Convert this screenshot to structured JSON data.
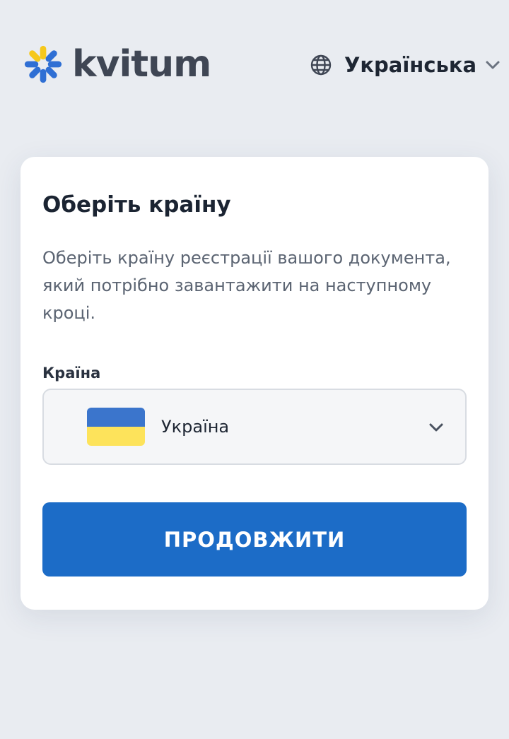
{
  "header": {
    "logo_text": "kvitum",
    "language": {
      "label": "Українська",
      "icon": "globe-icon"
    }
  },
  "card": {
    "title": "Оберіть країну",
    "description": "Оберіть країну реєстрації вашого документа, який потрібно завантажити на наступному кроці.",
    "country_field": {
      "label": "Країна",
      "selected_value": "Україна",
      "flag": {
        "top_color": "#3b75cc",
        "bottom_color": "#fde35b"
      }
    },
    "continue_label": "ПРОДОВЖИТИ"
  },
  "colors": {
    "background": "#e9ecf1",
    "primary": "#1c6cc7",
    "logo_blue": "#2f6fd4",
    "logo_yellow": "#f6c81c",
    "text_dark": "#1b2432"
  }
}
